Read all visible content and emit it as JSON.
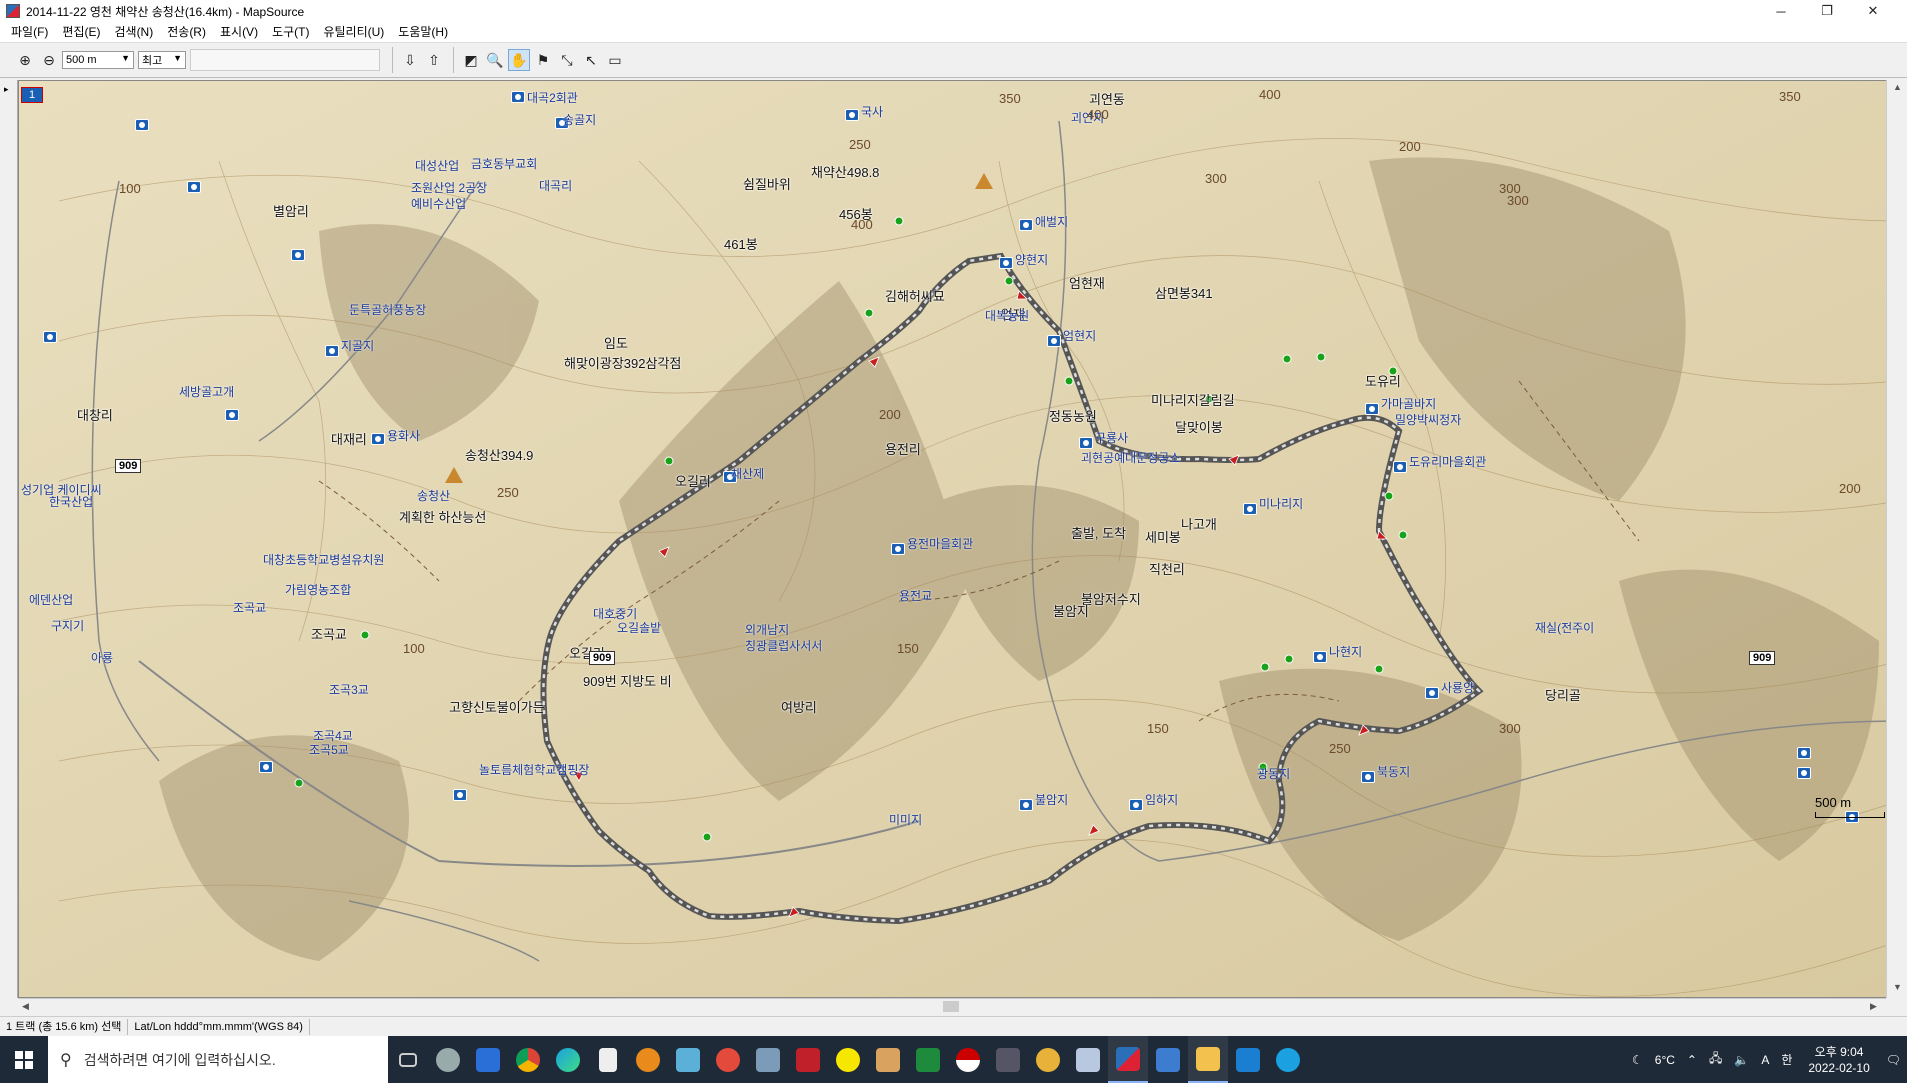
{
  "window": {
    "title": "2014-11-22 영천 채약산 송청산(16.4km) - MapSource"
  },
  "menu": [
    "파일(F)",
    "편집(E)",
    "검색(N)",
    "전송(R)",
    "표시(V)",
    "도구(T)",
    "유틸리티(U)",
    "도움말(H)"
  ],
  "toolbar": {
    "zoom_value": "500 m",
    "detail_value": "최고"
  },
  "map": {
    "badge": "1",
    "scale": "500 m",
    "labels": {
      "chaeyaksan": "채약산498.8",
      "swimjil": "쉼질바위",
      "peak456": "456봉",
      "peak461": "461봉",
      "imdo": "임도",
      "haemaji": "해맞이광장392삼각점",
      "songcheongsan": "송청산394.9",
      "planned": "계획한 하산능선",
      "gimhae": "김해허씨묘",
      "eomhyeonjae": "엄현재",
      "samyeon": "삼면봉341",
      "eomjae": "엄재",
      "minari": "미나리지갈림길",
      "dalmaji": "달맞이봉",
      "nagogae": "나고개",
      "chulbal": "출발, 도착",
      "semibong": "세미봉",
      "bulam": "불암저수지",
      "bulamji": "불암지",
      "road909": "909번 지방도 비",
      "ogili": "오길리",
      "jogokgyo": "조곡교",
      "gohyang": "고향신토불이가든",
      "jeongdong": "정동농원",
      "yongjeonri": "용전리",
      "bonsan": "본촌지",
      "daechang": "대창",
      "ogilri2": "오길리"
    },
    "pois": [
      "대곡2회관",
      "송골지",
      "대성산업",
      "금호동부교회",
      "조원산업 2공장",
      "예비수산업",
      "대곡리",
      "국사",
      "괴연동",
      "괴연지",
      "애벌지",
      "양현지",
      "대복농원",
      "엄현지",
      "용화사",
      "지골지",
      "세방골고개",
      "둔특골허풍농장",
      "송청산",
      "대창초등학교병설유치원",
      "가림영농조합",
      "조곡교",
      "조곡3교",
      "조곡4교",
      "조곡5교",
      "구룡사",
      "괴현공예대문정공소",
      "용전마을회관",
      "미나리지",
      "도유리",
      "가마골바지",
      "밀양박씨정자",
      "도유리마을회관",
      "채산제",
      "대호중기",
      "오길솔밭",
      "외개남지",
      "칭광클럽사서서",
      "용전교",
      "여방리",
      "직천리",
      "사룡양",
      "나현지",
      "재실(전주이",
      "북동지",
      "당리골",
      "불암지",
      "임하지",
      "미미지",
      "놀토름체험학교캠핑장",
      "구지기",
      "에덴산업",
      "대창리",
      "성기업 케이디씨",
      "한국산업",
      "아룡",
      "대재리",
      "별암리",
      "광동지"
    ],
    "road_badges": [
      "909",
      "909",
      "909"
    ],
    "contours": [
      "350",
      "400",
      "250",
      "300",
      "400",
      "200",
      "300",
      "100",
      "200",
      "150",
      "250",
      "300",
      "350",
      "400",
      "100",
      "150",
      "200",
      "250",
      "300"
    ]
  },
  "statusbar": {
    "selection": "1 트랙 (총 15.6 km) 선택",
    "coord_format": "Lat/Lon hddd°mm.mmm'(WGS 84)"
  },
  "taskbar": {
    "search_placeholder": "검색하려면 여기에 입력하십시오.",
    "weather": "6°C",
    "ime": "A",
    "lang": "한",
    "time": "오후 9:04",
    "date": "2022-02-10"
  }
}
